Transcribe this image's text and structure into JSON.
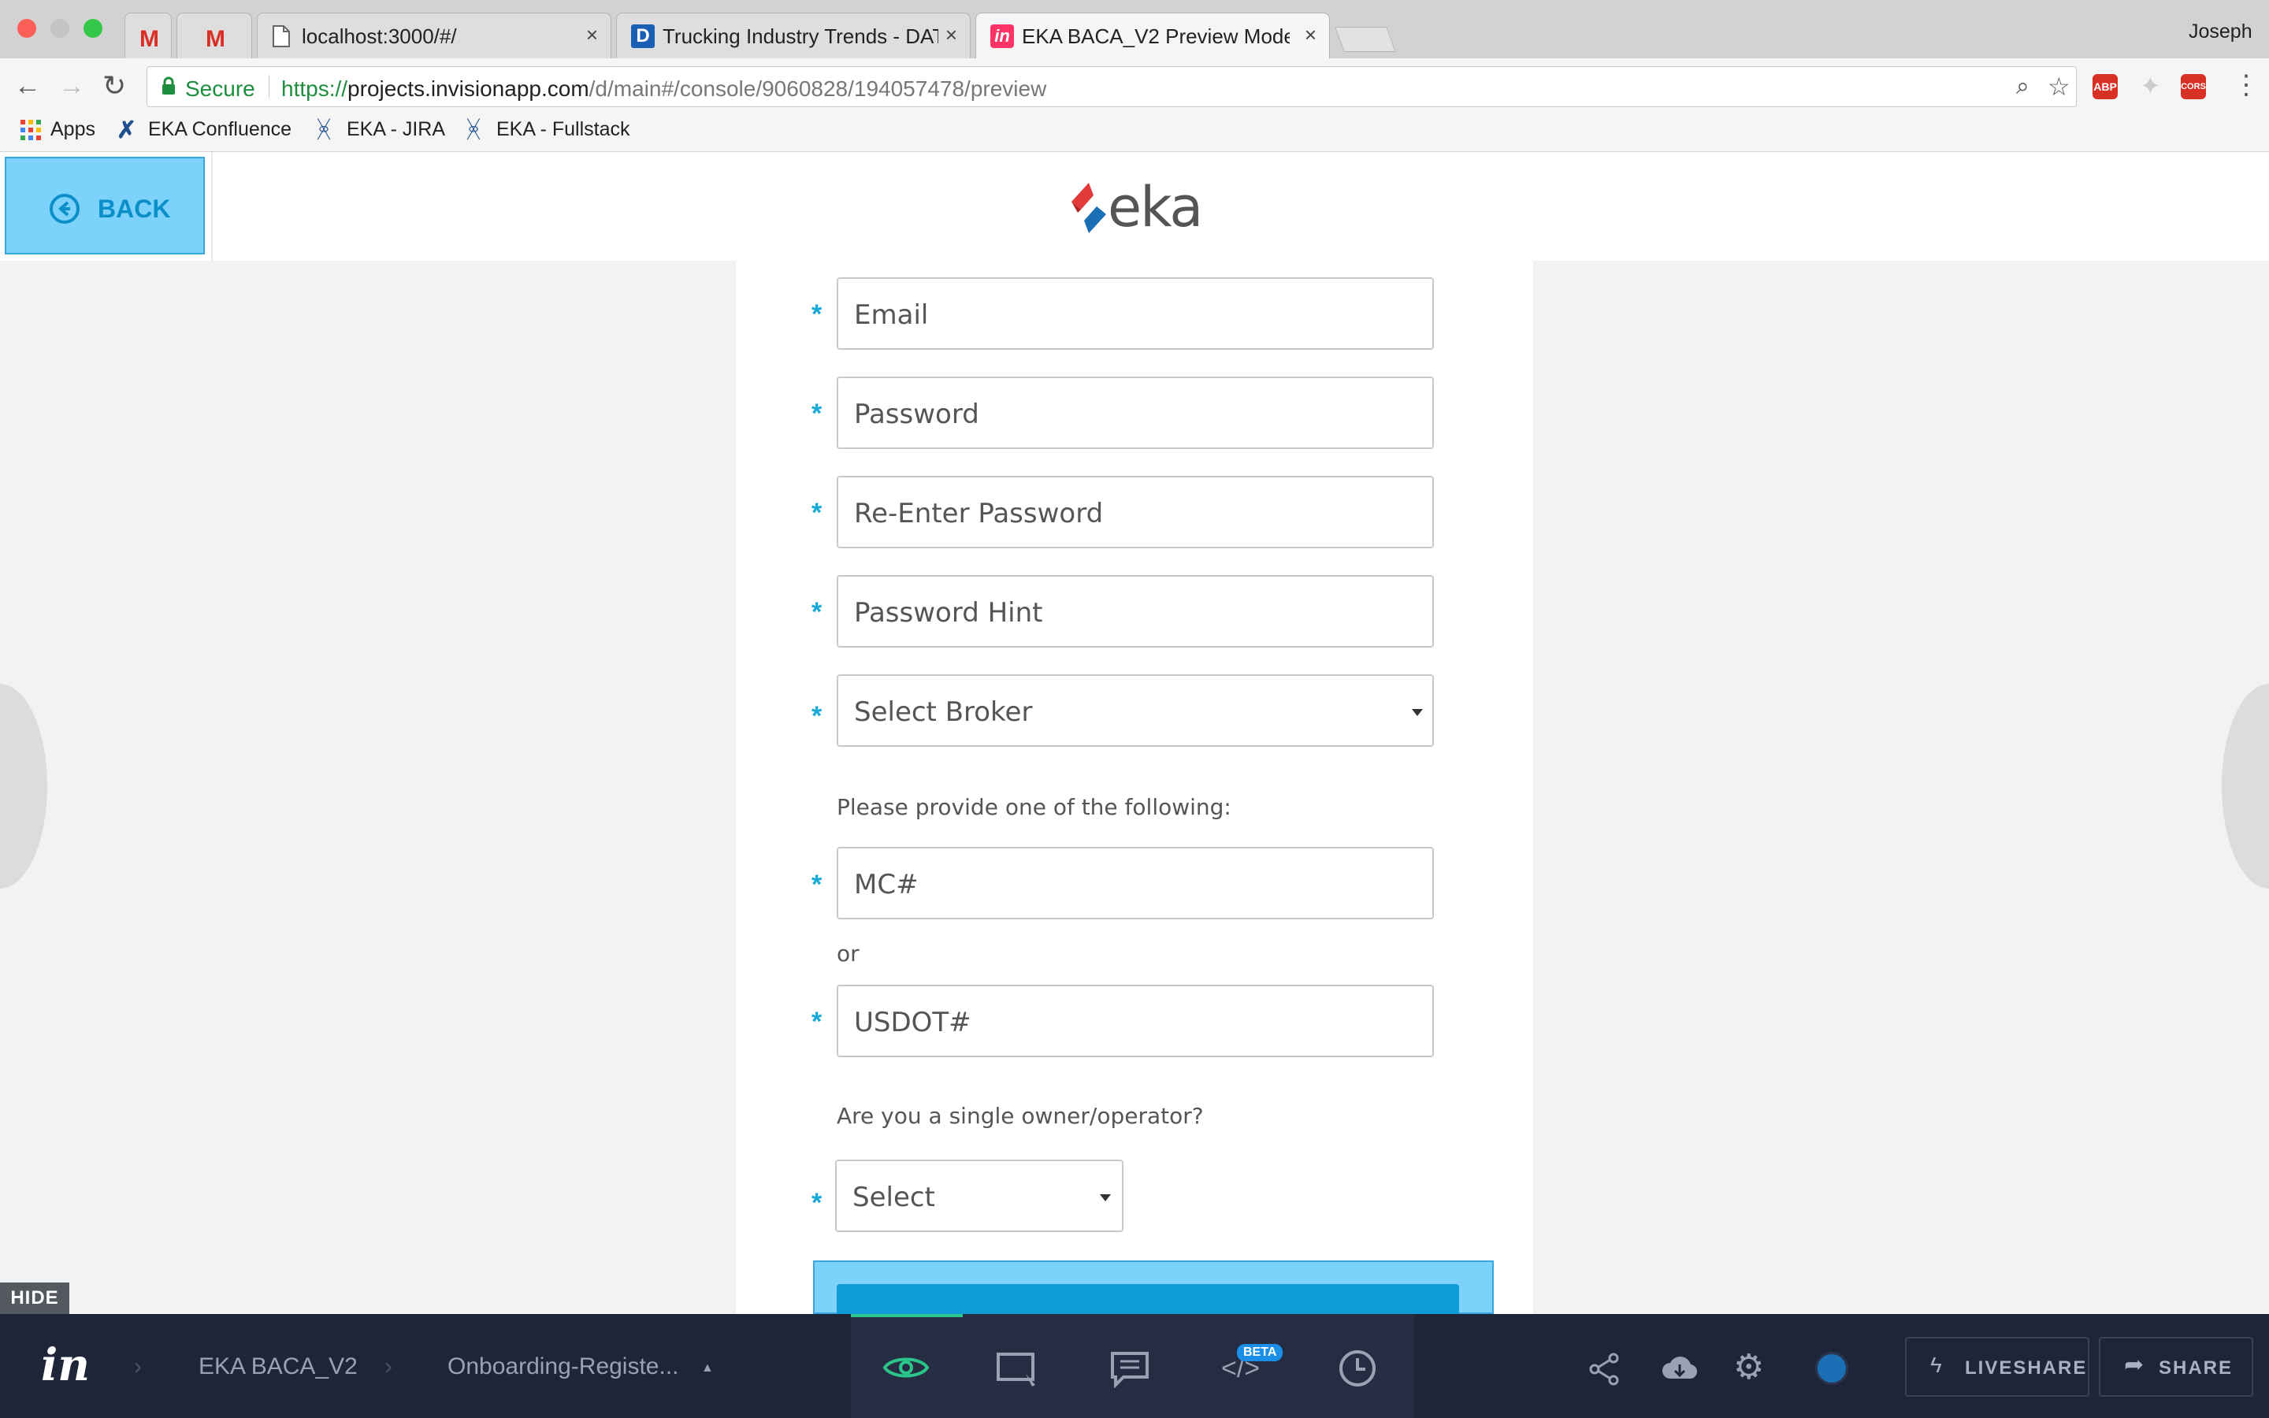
{
  "browser": {
    "user": "Joseph",
    "tabs": [
      {
        "title": "",
        "icon": "gmail-icon"
      },
      {
        "title": "",
        "icon": "gmail-icon"
      },
      {
        "title": "localhost:3000/#/",
        "icon": "page-icon"
      },
      {
        "title": "Trucking Industry Trends - DAT",
        "icon": "dat-icon"
      },
      {
        "title": "EKA BACA_V2 Preview Mode - I",
        "icon": "invision-icon"
      }
    ],
    "address": {
      "secure_label": "Secure",
      "scheme": "https://",
      "host": "projects.invisionapp.com",
      "path": "/d/main#/console/9060828/194057478/preview"
    },
    "bookmarks": [
      "Apps",
      "EKA Confluence",
      "EKA - JIRA",
      "EKA - Fullstack"
    ]
  },
  "header": {
    "back_label": "BACK",
    "logo_text": "eka"
  },
  "form": {
    "email_placeholder": "Email",
    "password_placeholder": "Password",
    "reenter_placeholder": "Re-Enter Password",
    "hint_placeholder": "Password Hint",
    "broker_select": "Select Broker",
    "provide_label": "Please provide one of the following:",
    "mc_placeholder": "MC#",
    "or_label": "or",
    "usdot_placeholder": "USDOT#",
    "owner_question": "Are you a single owner/operator?",
    "owner_select": "Select",
    "required_mark": "*"
  },
  "bottombar": {
    "hide_label": "HIDE",
    "project": "EKA BACA_V2",
    "screen": "Onboarding-Registe...",
    "beta_label": "BETA",
    "liveshare_label": "LIVESHARE",
    "share_label": "SHARE"
  },
  "colors": {
    "accent": "#17a9d6",
    "back_button": "#7cd2fb",
    "bottombar": "#1e2538",
    "view_active": "#2bc48a"
  }
}
